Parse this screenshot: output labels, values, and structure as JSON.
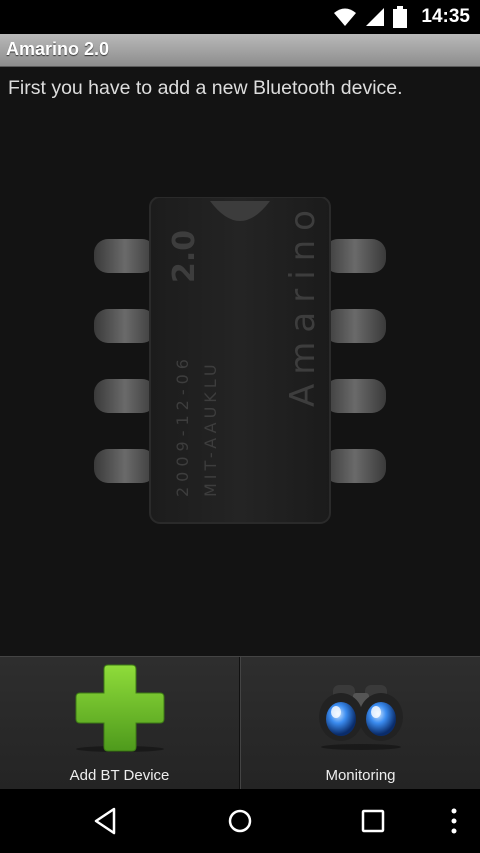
{
  "status_bar": {
    "time": "14:35",
    "icons": [
      "wifi-icon",
      "signal-icon",
      "battery-icon"
    ]
  },
  "app": {
    "title": "Amarino 2.0"
  },
  "main": {
    "instruction": "First you have to add a new Bluetooth device.",
    "chip_labels": {
      "version": "2.0",
      "name": "Amarino",
      "date": "2009-12-06",
      "origin": "MIT-AAUKLU"
    }
  },
  "actions": [
    {
      "label": "Add BT Device",
      "icon": "plus-icon"
    },
    {
      "label": "Monitoring",
      "icon": "binoculars-icon"
    }
  ],
  "nav_bar": {
    "icons": [
      "back-icon",
      "home-icon",
      "recents-icon",
      "overflow-menu-icon"
    ]
  },
  "colors": {
    "title_bar": "#a3a3a3",
    "background": "#131313",
    "plus_green": "#6cbf2a",
    "lens_blue": "#2a7ad6"
  }
}
